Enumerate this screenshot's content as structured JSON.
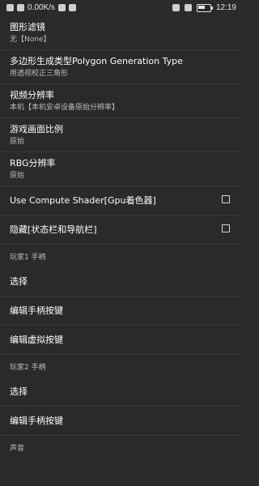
{
  "status": {
    "speed": "0.00K/s",
    "time": "12:19",
    "battery_level": 0.6
  },
  "settings": {
    "filter": {
      "title": "图形滤镜",
      "subtitle": "无【None】"
    },
    "polygon": {
      "title": "多边形生成类型Polygon Generation Type",
      "subtitle": "用透视校正三角形"
    },
    "video_res": {
      "title": "视频分辨率",
      "subtitle": "本机【本机安卓设备原始分辨率】"
    },
    "aspect": {
      "title": "游戏画面比例",
      "subtitle": "原始"
    },
    "rbg_res": {
      "title": "RBG分辨率",
      "subtitle": "原始"
    },
    "compute_shader": {
      "label": "Use Compute Shader[Gpu着色器]"
    },
    "hide_bars": {
      "label": "隐藏[状态栏和导航栏]"
    },
    "player1": {
      "header": "玩家1 手柄",
      "select": "选择",
      "edit_gamepad": "编辑手柄按键",
      "edit_virtual": "编辑虚拟按键"
    },
    "player2": {
      "header": "玩家2 手柄",
      "select": "选择",
      "edit_gamepad": "编辑手柄按键"
    },
    "sound": {
      "header": "声音"
    }
  }
}
